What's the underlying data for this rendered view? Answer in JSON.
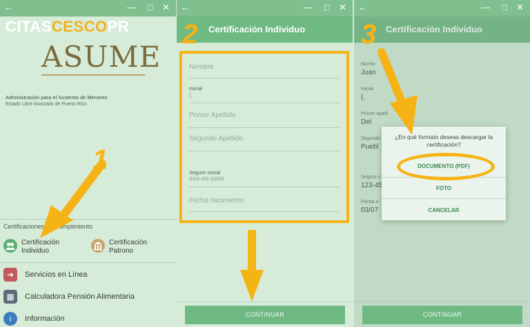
{
  "panel1": {
    "logo": {
      "part_a": "CITAS",
      "part_b": "CESCO",
      "part_c": "PR"
    },
    "asume": "ASUME",
    "subtitle_1": "Administración para el Sustento de Menores",
    "subtitle_2": "Estado Libre Asociado de Puerto Rico",
    "section_label": "Certificaciones de Cumplimiento",
    "tiles": [
      {
        "label": "Certificación\nIndividuo",
        "icon": "people-icon",
        "color": "#5cb071"
      },
      {
        "label": "Certificación\nPatrono",
        "icon": "building-icon",
        "color": "#c9a36d"
      }
    ],
    "menu": [
      {
        "label": "Servicios en Línea",
        "icon": "login-icon",
        "color": "#c2575c"
      },
      {
        "label": "Calculadora Pensión Alimentaria",
        "icon": "calculator-icon",
        "color": "#5a6a78"
      },
      {
        "label": "Información",
        "icon": "info-icon",
        "color": "#3b7bbf"
      }
    ],
    "step": "1"
  },
  "panel2": {
    "title": "Certificación Individuo",
    "fields": {
      "nombre": "Nombre",
      "inicial_label": "Inicial",
      "inicial_value": "(.",
      "primer_apellido": "Primer Apellido",
      "segundo_apellido": "Segundo Apellido",
      "seguro_label": "Seguro social",
      "seguro_placeholder": "###-##-####",
      "fecha": "Fecha nacimiento"
    },
    "continue": "CONTINUAR",
    "step": "2"
  },
  "panel3": {
    "title": "Certificación Individuo",
    "fields": [
      {
        "label": "Nombr",
        "value": "Juan"
      },
      {
        "label": "Inicial",
        "value": "(."
      },
      {
        "label": "Primer Apelli",
        "value": "Del"
      },
      {
        "label": "Segundo",
        "value": "Puebl"
      },
      {
        "label": "Seguro s",
        "value": "123-45"
      },
      {
        "label": "Fecha n",
        "value": "03/07"
      }
    ],
    "dialog": {
      "question": "¿En qué formato deseas descargar la certificación?",
      "option_pdf": "DOCUMENTO (PDF)",
      "option_foto": "FOTO",
      "option_cancel": "CANCELAR"
    },
    "continue": "CONTINUAR",
    "step": "3"
  },
  "colors": {
    "accent": "#f6b315",
    "appbar": "#6fb983",
    "titlebar": "#7fc08e"
  },
  "window_icons": {
    "back": "←",
    "minimize": "—",
    "maximize": "□",
    "close": "✕"
  }
}
